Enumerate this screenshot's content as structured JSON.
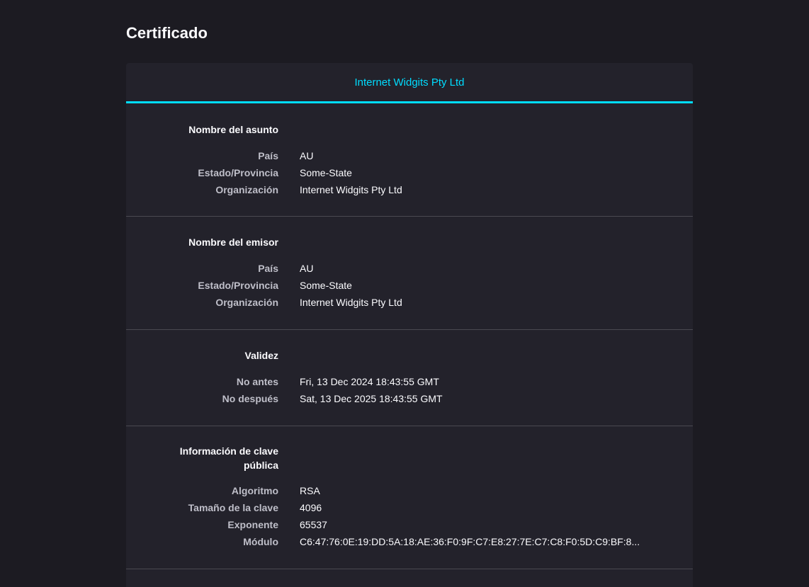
{
  "page": {
    "title": "Certificado"
  },
  "tabs": [
    {
      "label": "Internet Widgits Pty Ltd"
    }
  ],
  "subject": {
    "heading": "Nombre del asunto",
    "rows": [
      {
        "label": "País",
        "value": "AU"
      },
      {
        "label": "Estado/Provincia",
        "value": "Some-State"
      },
      {
        "label": "Organización",
        "value": "Internet Widgits Pty Ltd"
      }
    ]
  },
  "issuer": {
    "heading": "Nombre del emisor",
    "rows": [
      {
        "label": "País",
        "value": "AU"
      },
      {
        "label": "Estado/Provincia",
        "value": "Some-State"
      },
      {
        "label": "Organización",
        "value": "Internet Widgits Pty Ltd"
      }
    ]
  },
  "validity": {
    "heading": "Validez",
    "rows": [
      {
        "label": "No antes",
        "value": "Fri, 13 Dec 2024 18:43:55 GMT"
      },
      {
        "label": "No después",
        "value": "Sat, 13 Dec 2025 18:43:55 GMT"
      }
    ]
  },
  "public_key": {
    "heading_line1": "Información de clave",
    "heading_line2": "pública",
    "rows": [
      {
        "label": "Algoritmo",
        "value": "RSA"
      },
      {
        "label": "Tamaño de la clave",
        "value": "4096"
      },
      {
        "label": "Exponente",
        "value": "65537"
      },
      {
        "label": "Módulo",
        "value": "C6:47:76:0E:19:DD:5A:18:AE:36:F0:9F:C7:E8:27:7E:C7:C8:F0:5D:C9:BF:8..."
      }
    ]
  },
  "colors": {
    "background": "#1c1b22",
    "card": "#23222b",
    "accent": "#00ddff",
    "divider": "#4a4951"
  }
}
